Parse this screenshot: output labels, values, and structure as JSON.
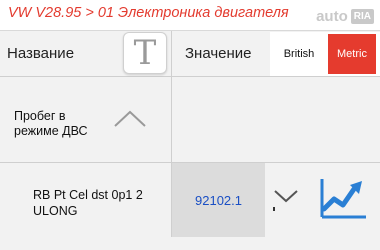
{
  "title_bar": {
    "title": "VW V28.95 > 01 Электроника двигателя",
    "watermark_auto": "auto",
    "watermark_ria": "RIA"
  },
  "header": {
    "name_label": "Название",
    "font_toggle_glyph": "T",
    "value_label": "Значение",
    "units": {
      "british": "British",
      "metric": "Metric",
      "selected": "metric"
    }
  },
  "group": {
    "label": "Пробег в режиме ДВС",
    "state": "expanded",
    "icon": "chevron-up-icon"
  },
  "parameter": {
    "name": "RB Pt Cel dst 0p1 2 ULONG",
    "value": "92102.1",
    "dropdown_icon": "chevron-down-icon",
    "graph_icon": "line-chart-icon"
  },
  "colors": {
    "title": "#e33b2f",
    "metric_active": "#e53b2e",
    "value_text": "#1a4fc4",
    "chart_icon": "#2a7fd4"
  }
}
